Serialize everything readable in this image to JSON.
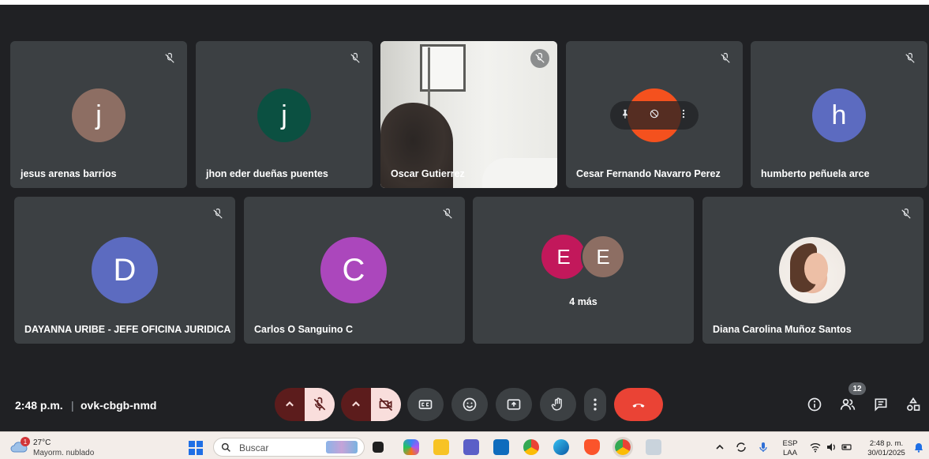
{
  "participants": [
    {
      "name": "jesus arenas barrios",
      "initial": "j",
      "color": "#8d6e63"
    },
    {
      "name": "jhon eder dueñas puentes",
      "initial": "j",
      "color": "#0b5041"
    },
    {
      "name": "Oscar Gutierrez",
      "initial": "",
      "color": ""
    },
    {
      "name": "Cesar Fernando Navarro Perez",
      "initial": "",
      "color": "#f4511e"
    },
    {
      "name": "humberto peñuela arce",
      "initial": "h",
      "color": "#5c6bc0"
    },
    {
      "name": "DAYANNA URIBE - JEFE OFICINA JURIDICA",
      "initial": "D",
      "color": "#5c6bc0"
    },
    {
      "name": "Carlos O Sanguino C",
      "initial": "C",
      "color": "#ab47bc"
    },
    {
      "name": "Diana Carolina Muñoz Santos",
      "initial": "",
      "color": ""
    }
  ],
  "more_tile": {
    "label": "4 más",
    "avatars": [
      {
        "initial": "E",
        "color": "#c2185b"
      },
      {
        "initial": "E",
        "color": "#8d6e63"
      }
    ]
  },
  "meeting": {
    "time": "2:48 p.m.",
    "separator": "|",
    "code": "ovk-cbgb-nmd",
    "participant_count": "12"
  },
  "colors": {
    "stage": "#202124",
    "tile": "#3c4043",
    "end_call": "#ea4335",
    "muted_btn": "#f9dedc"
  },
  "icons": {
    "mic_off": "mic-off-icon",
    "cam_off": "videocam-off-icon",
    "captions": "captions-icon",
    "emoji": "emoji-icon",
    "present": "present-icon",
    "hand": "raise-hand-icon",
    "more": "more-vert-icon",
    "end": "call-end-icon",
    "info": "info-icon",
    "people": "people-icon",
    "chat": "chat-icon",
    "activities": "activities-icon"
  },
  "taskbar": {
    "weather_temp": "27°C",
    "weather_desc": "Mayorm. nublado",
    "weather_badge": "1",
    "search_placeholder": "Buscar",
    "lang_top": "ESP",
    "lang_bottom": "LAA",
    "clock_time": "2:48 p. m.",
    "clock_date": "30/01/2025"
  }
}
